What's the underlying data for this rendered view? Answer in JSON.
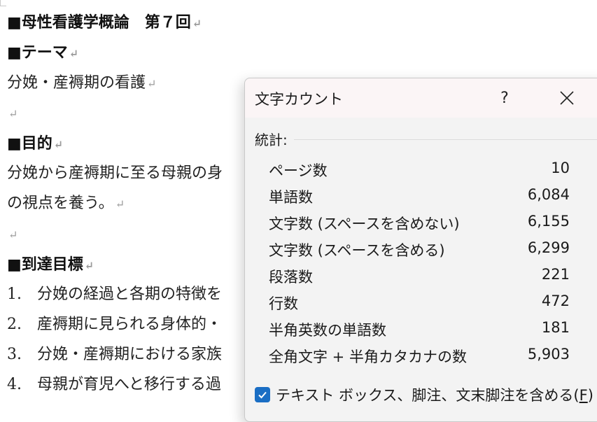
{
  "document": {
    "lines": [
      {
        "text": "■母性看護学概論　第７回",
        "mark": "↵",
        "bold": true
      },
      {
        "text": "■テーマ",
        "mark": "↵",
        "bold": true
      },
      {
        "text": "分娩・産褥期の看護",
        "mark": "↵",
        "bold": false
      },
      {
        "text": "",
        "mark": "↵",
        "bold": false
      },
      {
        "text": "■目的",
        "mark": "↵",
        "bold": true
      },
      {
        "text": "分娩から産褥期に至る母親の身",
        "mark": "",
        "bold": false
      },
      {
        "text": "の視点を養う。",
        "mark": "↵",
        "bold": false
      },
      {
        "text": "",
        "mark": "↵",
        "bold": false
      },
      {
        "text": "■到達目標",
        "mark": "↵",
        "bold": true
      },
      {
        "text": "1.　分娩の経過と各期の特徴を",
        "mark": "",
        "bold": false
      },
      {
        "text": "2.　産褥期に見られる身体的・",
        "mark": "",
        "bold": false
      },
      {
        "text": "3.　分娩・産褥期における家族",
        "mark": "",
        "bold": false
      },
      {
        "text": "4.　母親が育児へと移行する過",
        "mark": "",
        "bold": false
      }
    ]
  },
  "dialog": {
    "title": "文字カウント",
    "help_label": "?",
    "section_label": "統計:",
    "stats": [
      {
        "label": "ページ数",
        "value": "10"
      },
      {
        "label": "単語数",
        "value": "6,084"
      },
      {
        "label": "文字数 (スペースを含めない)",
        "value": "6,155"
      },
      {
        "label": "文字数 (スペースを含める)",
        "value": "6,299"
      },
      {
        "label": "段落数",
        "value": "221"
      },
      {
        "label": "行数",
        "value": "472"
      },
      {
        "label": "半角英数の単語数",
        "value": "181"
      },
      {
        "label": "全角文字 + 半角カタカナの数",
        "value": "5,903"
      }
    ],
    "checkbox_label": "テキスト ボックス、脚注、文末脚注を含める(",
    "checkbox_accel": "F",
    "checkbox_label_end": ")",
    "checkbox_checked": true,
    "accent_color": "#1a6ec4"
  }
}
